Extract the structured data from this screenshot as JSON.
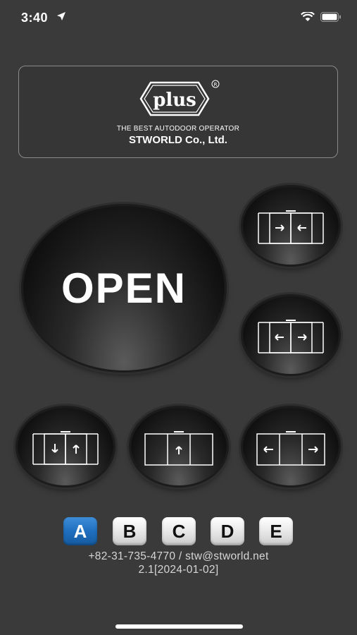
{
  "status_bar": {
    "time": "3:40"
  },
  "logo": {
    "brand": "plus",
    "registered": "®",
    "tagline": "THE BEST AUTODOOR OPERATOR",
    "company": "STWORLD Co., Ltd."
  },
  "controls": {
    "open_label": "OPEN"
  },
  "tabs": [
    {
      "label": "A",
      "active": true
    },
    {
      "label": "B",
      "active": false
    },
    {
      "label": "C",
      "active": false
    },
    {
      "label": "D",
      "active": false
    },
    {
      "label": "E",
      "active": false
    }
  ],
  "footer": {
    "contact": "+82-31-735-4770 / stw@stworld.net",
    "version": "2.1[2024-01-02]"
  },
  "colors": {
    "background": "#3a3a3a",
    "active_tab": "#1f6fbf"
  }
}
